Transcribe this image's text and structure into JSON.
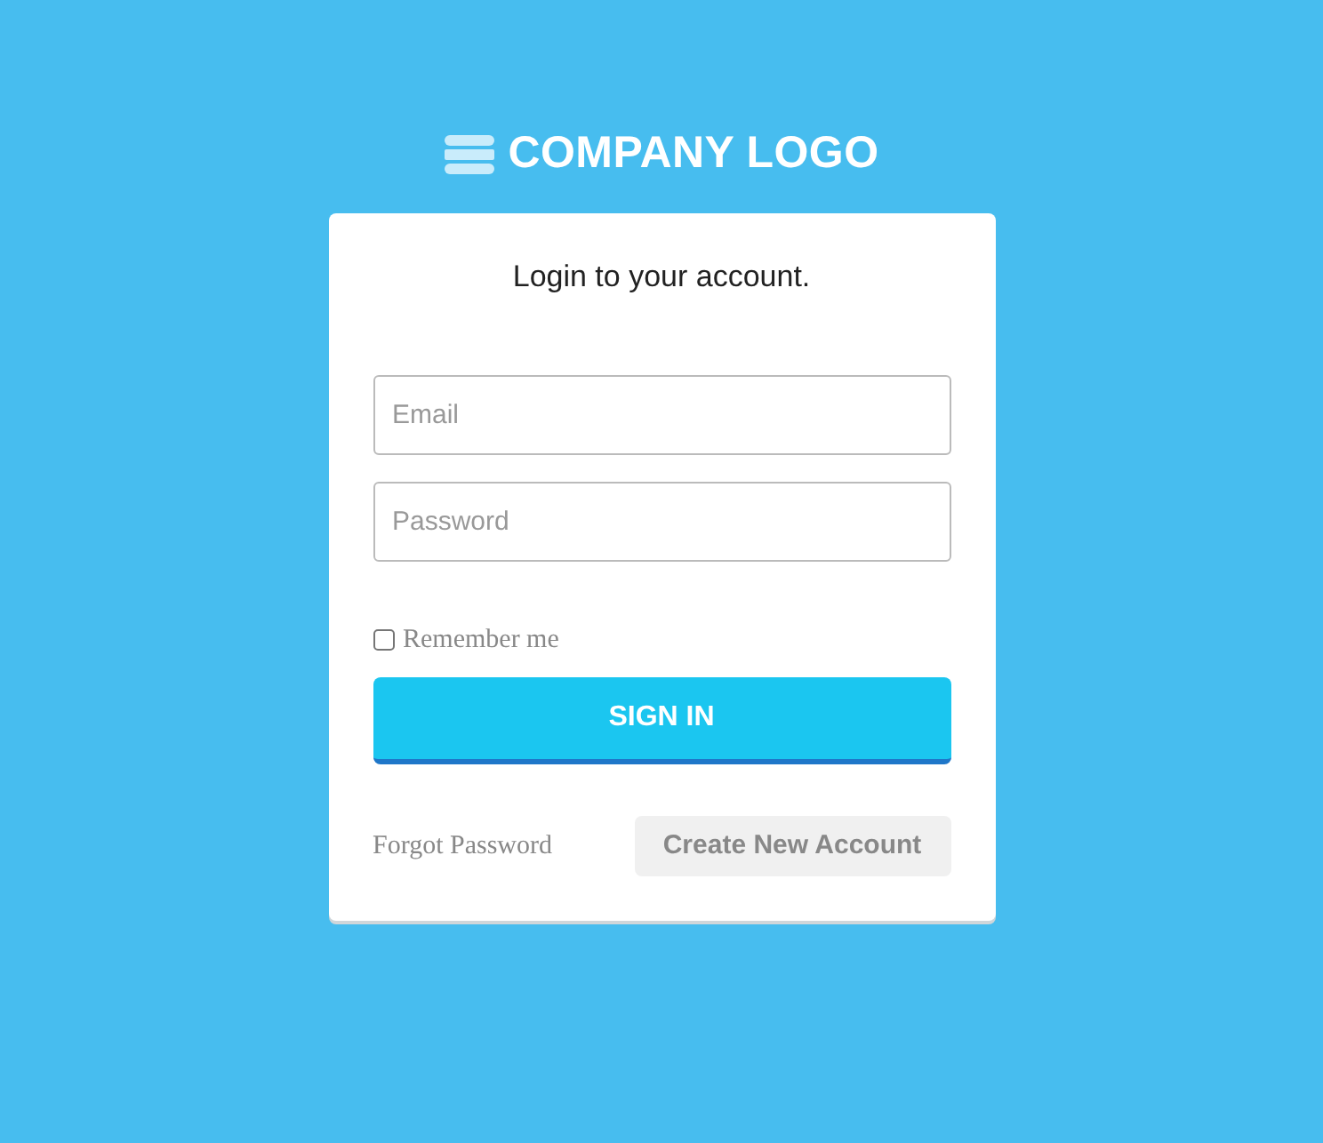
{
  "logo": {
    "text": "COMPANY LOGO"
  },
  "card": {
    "title": "Login to your account."
  },
  "fields": [
    {
      "placeholder": "Email"
    },
    {
      "placeholder": "Password"
    }
  ],
  "remember": {
    "label": "Remember me",
    "checked": false
  },
  "sign_in": {
    "label": "SIGN IN"
  },
  "links": {
    "forgot": "Forgot Password",
    "create": "Create New Account"
  }
}
